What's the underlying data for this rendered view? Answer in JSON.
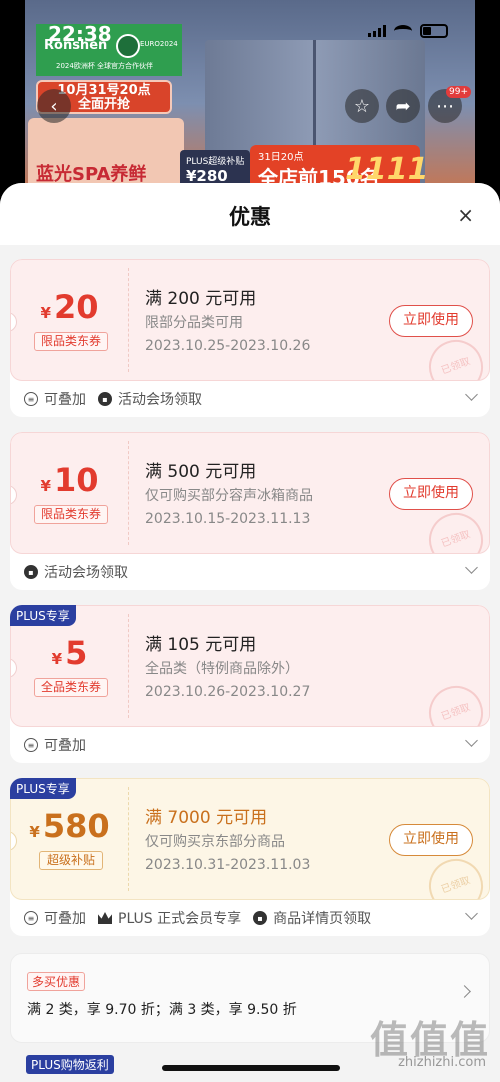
{
  "status_bar": {
    "time": "22:38"
  },
  "background": {
    "brand": "Ronshen",
    "brand_sub": "2024欧洲杯 全球官方合作伙伴",
    "euro_label": "EURO2024",
    "date_banner_l1": "10月31号20点",
    "date_banner_l2": "全面开抢",
    "sale_title": "蓝光SPA养鲜",
    "plus_label": "PLUS超级补贴",
    "plus_price": "¥280",
    "promo_tag": "31日20点",
    "promo_big": "全店前150名",
    "promo_1111": "1111",
    "badge_count": "99+"
  },
  "sheet": {
    "title": "优惠",
    "close": "×"
  },
  "coupons": [
    {
      "currency": "¥",
      "amount": "20",
      "type": "限品类东券",
      "condition": "满 200 元可用",
      "scope": "限部分品类可用",
      "period": "2023.10.25-2023.10.26",
      "button": "立即使用",
      "stamp": "已领取",
      "plus_tag": "",
      "features": [
        "可叠加",
        "活动会场领取"
      ]
    },
    {
      "currency": "¥",
      "amount": "10",
      "type": "限品类东券",
      "condition": "满 500 元可用",
      "scope": "仅可购买部分容声冰箱商品",
      "period": "2023.10.15-2023.11.13",
      "button": "立即使用",
      "stamp": "已领取",
      "plus_tag": "",
      "features": [
        "活动会场领取"
      ]
    },
    {
      "currency": "¥",
      "amount": "5",
      "type": "全品类东券",
      "condition": "满 105 元可用",
      "scope": "全品类（特例商品除外）",
      "period": "2023.10.26-2023.10.27",
      "button": "",
      "stamp": "已领取",
      "plus_tag": "PLUS专享",
      "features": [
        "可叠加"
      ]
    },
    {
      "currency": "¥",
      "amount": "580",
      "type": "超级补贴",
      "condition": "满 7000 元可用",
      "scope": "仅可购买京东部分商品",
      "period": "2023.10.31-2023.11.03",
      "button": "立即使用",
      "stamp": "已领取",
      "plus_tag": "PLUS专享",
      "features": [
        "可叠加",
        "PLUS 正式会员专享",
        "商品详情页领取"
      ]
    }
  ],
  "promo": {
    "tag": "多买优惠",
    "line": "满 2 类，享 9.70 折；满 3 类，享 9.50 折"
  },
  "plus_rebate": "PLUS购物返利",
  "watermark": {
    "logo": "值值值",
    "url": "zhizhizhi.com"
  },
  "colors": {
    "accent_red": "#e23b2e",
    "plus_blue": "#2b3fa0",
    "gold": "#c9701d"
  }
}
